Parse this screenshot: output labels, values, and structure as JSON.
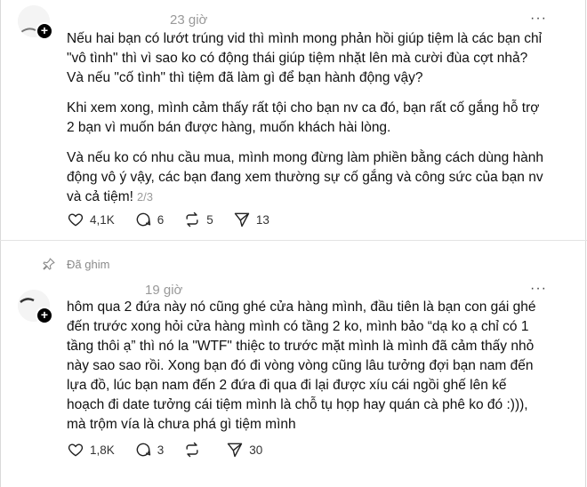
{
  "posts": [
    {
      "timestamp": "23 giờ",
      "more_label": "···",
      "paragraphs": [
        "Nếu hai bạn có lướt trúng vid thì mình mong phản hồi giúp tiệm là các bạn chỉ \"vô tình\" thì vì sao ko có động thái giúp tiệm nhặt lên mà cười đùa cợt nhả? Và nếu \"cố tình\" thì tiệm đã làm gì để bạn hành động vậy?",
        "Khi xem xong, mình cảm thấy rất tội cho bạn nv ca đó, bạn rất cố gắng hỗ trợ 2 bạn vì muốn bán được hàng, muốn khách hài lòng.",
        "Và nếu ko có nhu cầu mua, mình mong đừng làm phiền bằng cách dùng hành động vô ý vậy, các bạn đang xem thường sự cố gắng và công sức của bạn nv và cả tiệm!"
      ],
      "pager": "2/3",
      "likes": "4,1K",
      "comments": "6",
      "reposts": "5",
      "shares": "13"
    },
    {
      "pinned_label": "Đã ghim",
      "timestamp": "19 giờ",
      "more_label": "···",
      "paragraphs": [
        "hôm qua 2 đứa này nó cũng ghé cửa hàng mình, đầu tiên là bạn con gái ghé đến trước xong hỏi cửa hàng mình có tầng 2 ko, mình bảo “dạ ko ạ chỉ có 1 tầng thôi ạ” thì nó la \"WTF\" thiệc to trước mặt mình là mình đã cảm thấy nhỏ này sao sao rồi. Xong bạn đó đi vòng vòng cũng lâu tưởng đợi bạn nam đến lựa đồ, lúc bạn nam đến 2 đứa đi qua đi lại được xíu cái ngồi ghế lên kế hoạch đi date tưởng cái tiệm mình là chỗ tụ họp hay quán cà phê ko đó :))), mà trộm vía là chưa phá gì tiệm mình"
      ],
      "likes": "1,8K",
      "comments": "3",
      "reposts": "",
      "shares": "30"
    }
  ],
  "icons": {
    "like": "heart-icon",
    "comment": "comment-icon",
    "repost": "repost-icon",
    "share": "send-icon",
    "pin": "pin-icon",
    "follow": "plus-icon"
  }
}
